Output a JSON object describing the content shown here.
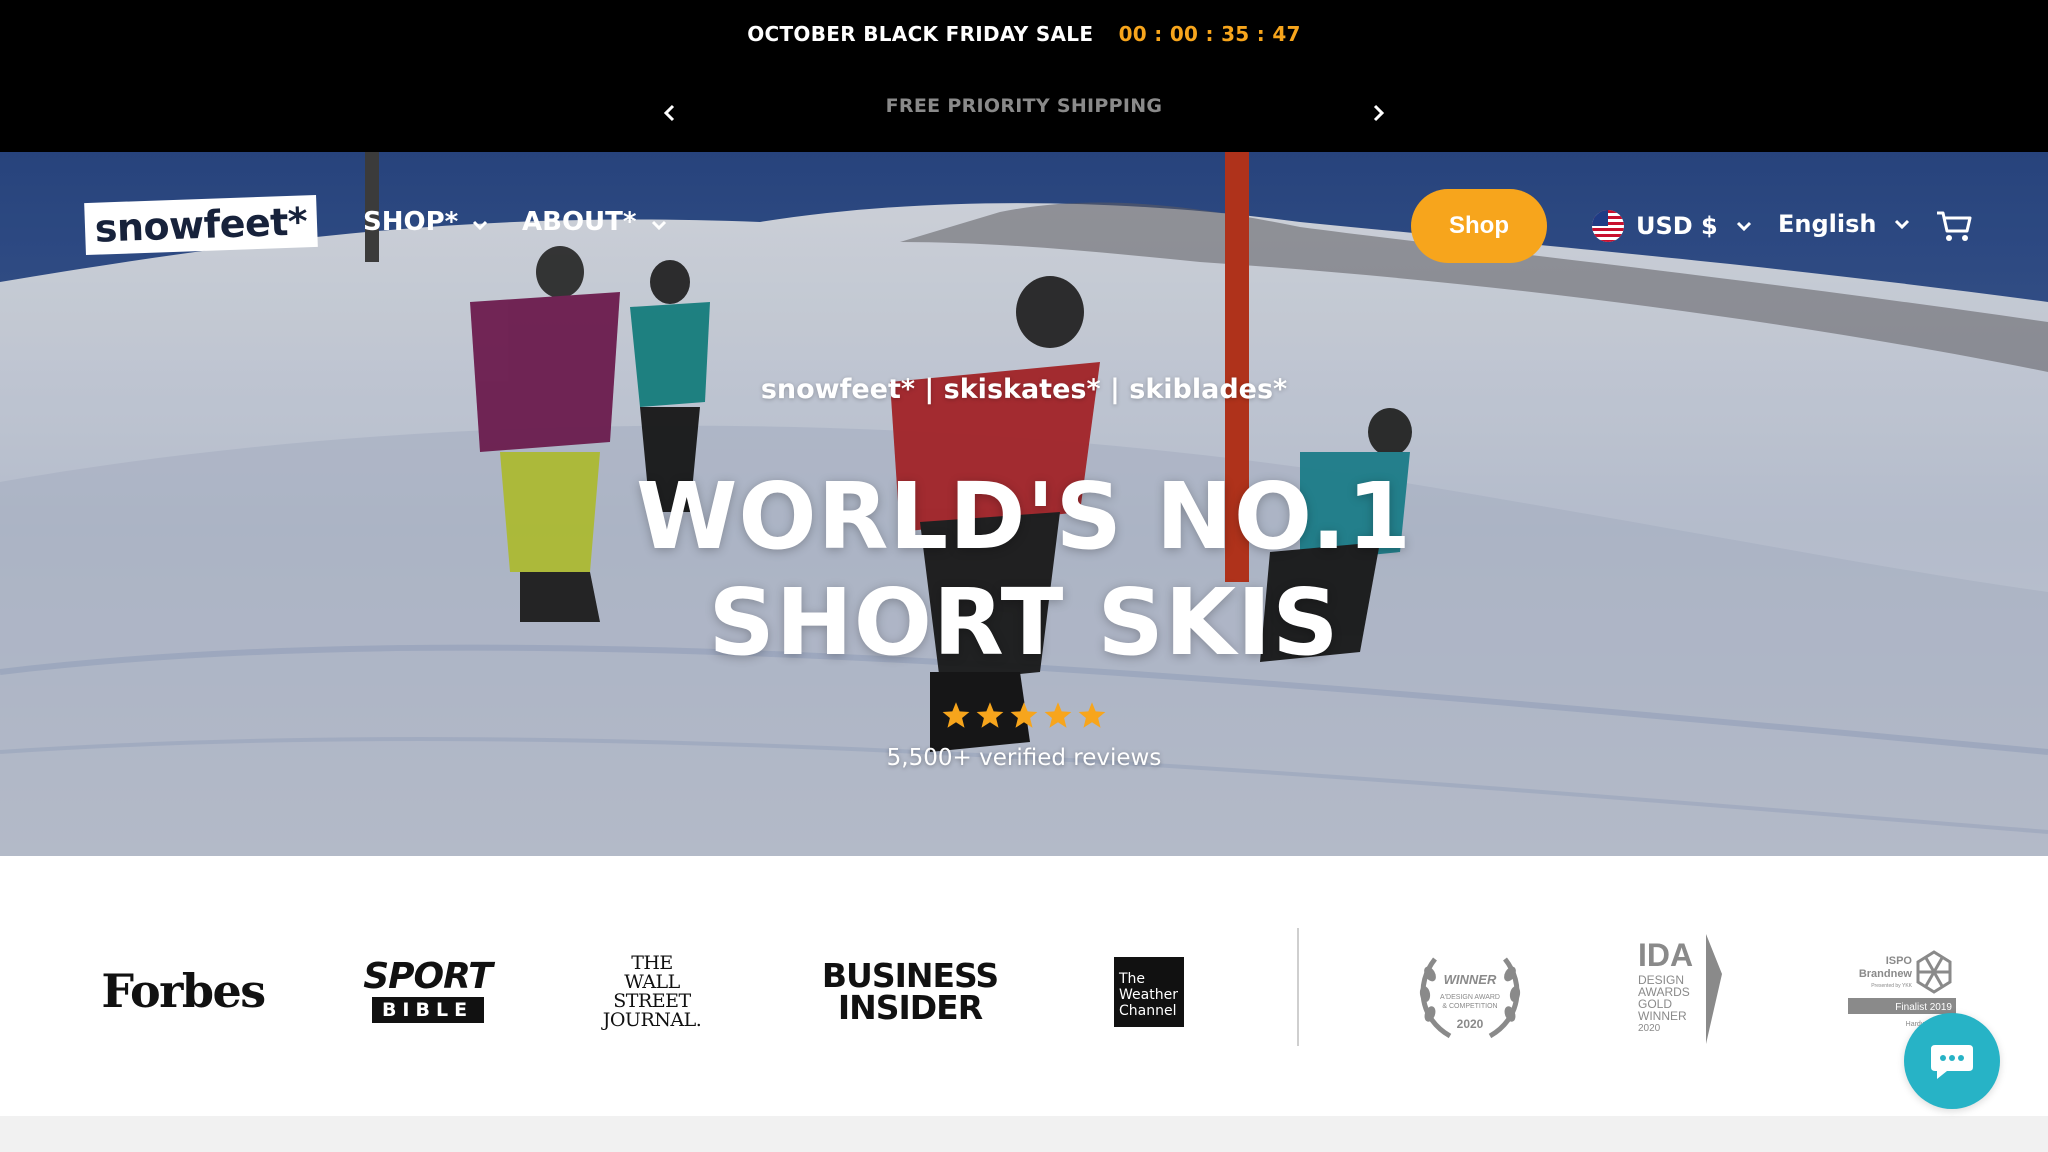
{
  "announcement": {
    "sale_text": "OCTOBER BLACK FRIDAY SALE",
    "countdown": "00 : 00 : 35 : 47",
    "shipping_text": "FREE PRIORITY SHIPPING",
    "prev_icon": "chevron-left-icon",
    "next_icon": "chevron-right-icon"
  },
  "header": {
    "logo_text": "snowfeet*",
    "nav": [
      {
        "label": "SHOP*",
        "icon": "chevron-down-icon"
      },
      {
        "label": "ABOUT*",
        "icon": "chevron-down-icon"
      }
    ],
    "shop_button": "Shop",
    "currency": "USD $",
    "currency_flag": "us-flag-icon",
    "language": "English",
    "cart_icon": "cart-icon"
  },
  "hero": {
    "tagline": "snowfeet* | skiskates* | skiblades*",
    "headline_line1": "WORLD'S NO.1",
    "headline_line2": "SHORT SKIS",
    "rating_stars": 5,
    "reviews_text": "5,500+ verified reviews"
  },
  "press": {
    "forbes": "Forbes",
    "sport_top": "SPORT",
    "sport_bottom": "BIBLE",
    "wsj_line1": "THE",
    "wsj_line2": "WALL STREET",
    "wsj_line3": "JOURNAL.",
    "bi_line1": "BUSINESS",
    "bi_line2": "INSIDER",
    "weather_line1": "The",
    "weather_line2": "Weather",
    "weather_line3": "Channel",
    "award1_title": "WINNER",
    "award1_sub1": "A'DESIGN AWARD",
    "award1_sub2": "& COMPETITION",
    "award1_year": "2020",
    "award2_logo": "IDA",
    "award2_l1": "DESIGN",
    "award2_l2": "AWARDS",
    "award2_l3": "GOLD",
    "award2_l4": "WINNER",
    "award2_year": "2020",
    "award3_l1": "ISPO",
    "award3_l2": "Brandnew",
    "award3_l3": "Presented by YKK",
    "award3_finalist": "Finalist 2019",
    "award3_l4": "Hardware"
  },
  "chat": {
    "icon": "chat-bubble-icon"
  },
  "colors": {
    "accent": "#f7a51c",
    "announcement_bg": "#000000",
    "chat_bg": "#27b3c6",
    "logo_text": "#17223b"
  }
}
